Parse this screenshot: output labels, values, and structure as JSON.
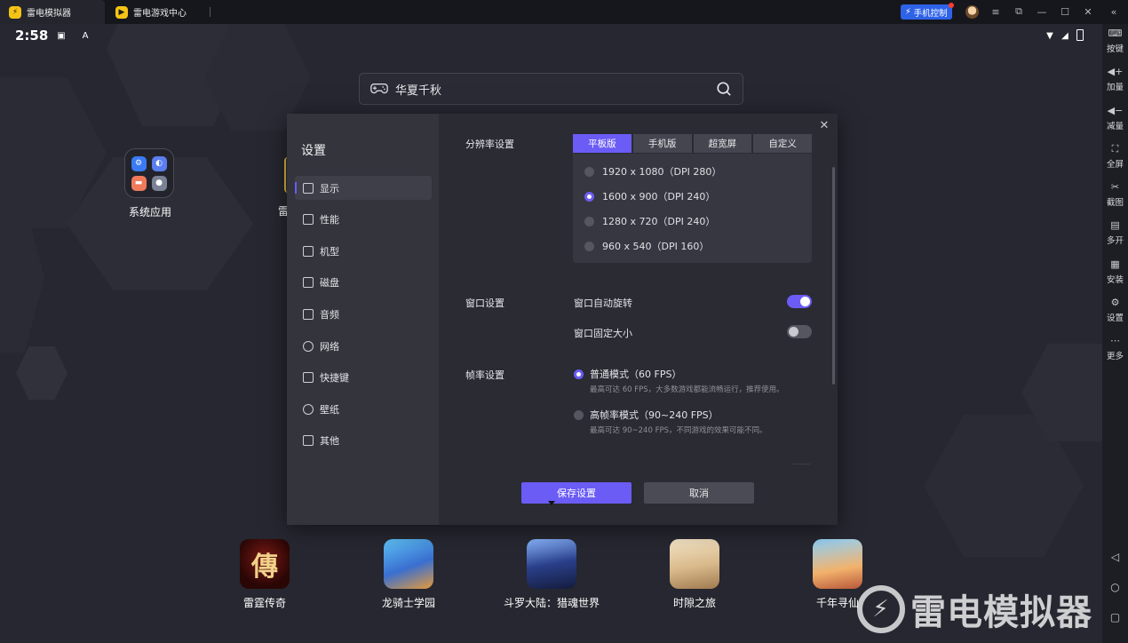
{
  "titlebar": {
    "tabs": [
      {
        "label": "雷电模拟器"
      },
      {
        "label": "雷电游戏中心"
      }
    ],
    "phone_control": "手机控制"
  },
  "statusbar": {
    "time": "2:58"
  },
  "search": {
    "value": "华夏千秋"
  },
  "desktop": {
    "system_apps_label": "系统应用",
    "partial_app_label": "雷"
  },
  "dock": [
    {
      "label": "雷霆传奇"
    },
    {
      "label": "龙骑士学园"
    },
    {
      "label": "斗罗大陆：猎魂世界"
    },
    {
      "label": "时隙之旅"
    },
    {
      "label": "千年寻仙"
    }
  ],
  "watermark": "雷电模拟器",
  "rightbar": [
    {
      "label": "按键",
      "icon": "keyboard-icon"
    },
    {
      "label": "加量",
      "icon": "volume-up-icon"
    },
    {
      "label": "减量",
      "icon": "volume-down-icon"
    },
    {
      "label": "全屏",
      "icon": "fullscreen-icon"
    },
    {
      "label": "截图",
      "icon": "scissors-icon"
    },
    {
      "label": "多开",
      "icon": "multi-instance-icon"
    },
    {
      "label": "安装",
      "icon": "install-icon"
    },
    {
      "label": "设置",
      "icon": "gear-icon"
    },
    {
      "label": "更多",
      "icon": "more-icon"
    }
  ],
  "settings": {
    "title": "设置",
    "menu": [
      {
        "label": "显示",
        "active": true
      },
      {
        "label": "性能"
      },
      {
        "label": "机型"
      },
      {
        "label": "磁盘"
      },
      {
        "label": "音频"
      },
      {
        "label": "网络"
      },
      {
        "label": "快捷键"
      },
      {
        "label": "壁纸"
      },
      {
        "label": "其他"
      }
    ],
    "resolution": {
      "label": "分辨率设置",
      "tabs": [
        "平板版",
        "手机版",
        "超宽屏",
        "自定义"
      ],
      "selected_tab": "平板版",
      "options": [
        "1920 x 1080（DPI 280）",
        "1600 x 900（DPI 240）",
        "1280 x 720（DPI 240）",
        "960 x 540（DPI 160）"
      ],
      "selected_option": "1600 x 900（DPI 240）"
    },
    "window": {
      "label": "窗口设置",
      "auto_rotate": {
        "label": "窗口自动旋转",
        "on": true
      },
      "fixed_size": {
        "label": "窗口固定大小",
        "on": false
      }
    },
    "fps": {
      "label": "帧率设置",
      "options": [
        {
          "label": "普通模式（60 FPS）",
          "desc": "最高可达 60 FPS，大多数游戏都能流畅运行，推荐使用。",
          "selected": true
        },
        {
          "label": "高帧率模式（90~240 FPS）",
          "desc": "最高可达 90~240 FPS，不同游戏的效果可能不同。",
          "selected": false
        }
      ]
    },
    "save_label": "保存设置",
    "cancel_label": "取消"
  },
  "colors": {
    "accent": "#6b5cf6",
    "phone_control": "#2e63e8"
  }
}
